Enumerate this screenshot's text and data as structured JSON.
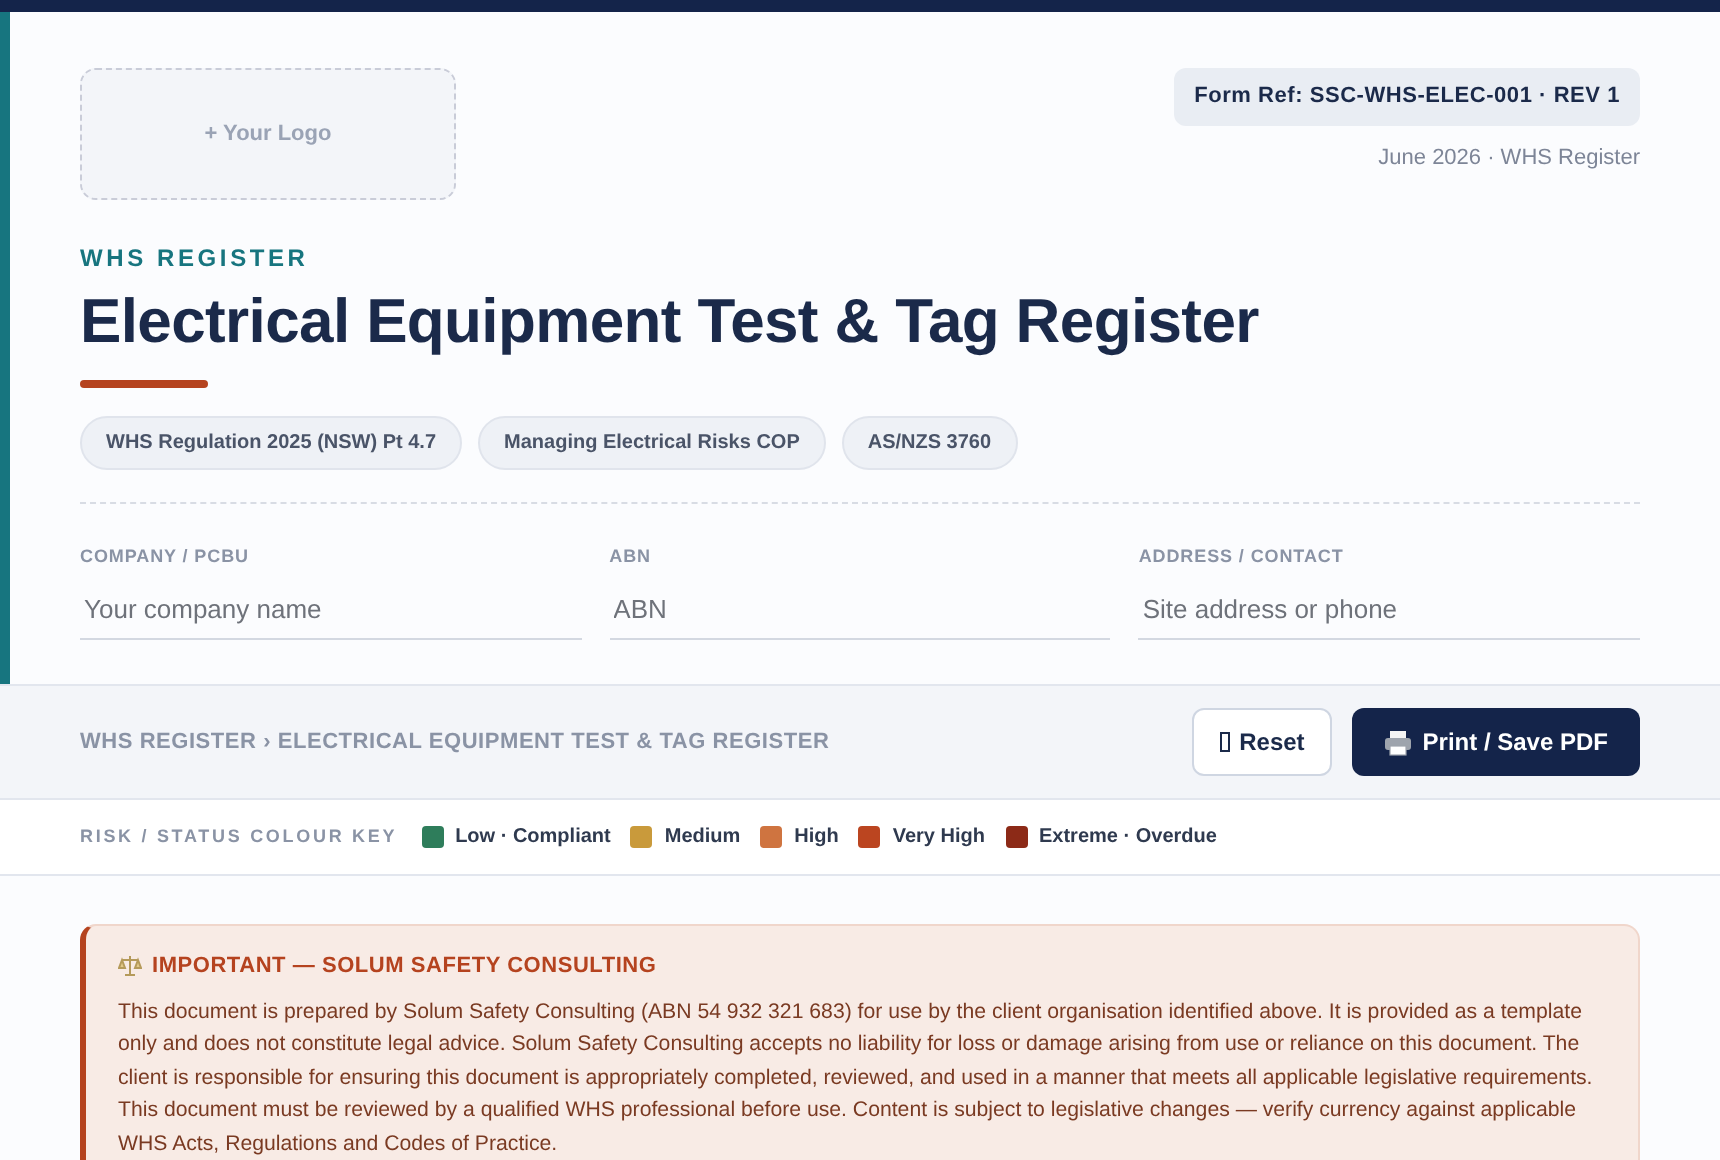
{
  "logo": {
    "label": "+ Your Logo"
  },
  "form_ref": "Form Ref: SSC-WHS-ELEC-001 · REV 1",
  "form_date": "June 2026 · WHS Register",
  "eyebrow": "WHS REGISTER",
  "title": "Electrical Equipment Test & Tag Register",
  "tags": [
    "WHS Regulation 2025 (NSW) Pt 4.7",
    "Managing Electrical Risks COP",
    "AS/NZS 3760"
  ],
  "fields": [
    {
      "label": "COMPANY / PCBU",
      "placeholder": "Your company name"
    },
    {
      "label": "ABN",
      "placeholder": "ABN"
    },
    {
      "label": "ADDRESS / CONTACT",
      "placeholder": "Site address or phone"
    }
  ],
  "toolbar": {
    "breadcrumb": "WHS REGISTER › ELECTRICAL EQUIPMENT TEST & TAG REGISTER",
    "buttons": [
      {
        "label": "Reset",
        "kind": "secondary"
      },
      {
        "label": "Print / Save PDF",
        "kind": "primary"
      }
    ]
  },
  "colour_key": {
    "title": "RISK / STATUS COLOUR KEY",
    "items": [
      {
        "label": "Low · Compliant",
        "color": "#2e7d5b"
      },
      {
        "label": "Medium",
        "color": "#c99a3b"
      },
      {
        "label": "High",
        "color": "#cf7440"
      },
      {
        "label": "Very High",
        "color": "#bb4520"
      },
      {
        "label": "Extreme · Overdue",
        "color": "#8c2a17"
      }
    ]
  },
  "notice": {
    "title": "IMPORTANT — SOLUM SAFETY CONSULTING",
    "text": "This document is prepared by Solum Safety Consulting (ABN 54 932 321 683) for use by the client organisation identified above. It is provided as a template only and does not constitute legal advice. Solum Safety Consulting accepts no liability for loss or damage arising from use or reliance on this document. The client is responsible for ensuring this document is appropriately completed, reviewed, and used in a manner that meets all applicable legislative requirements. This document must be reviewed by a qualified WHS professional before use. Content is subject to legislative changes — verify currency against applicable WHS Acts, Regulations and Codes of Practice."
  }
}
